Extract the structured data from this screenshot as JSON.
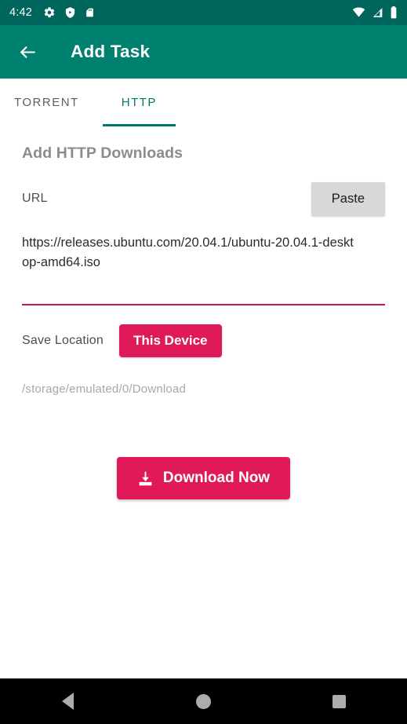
{
  "status_bar": {
    "clock": "4:42",
    "left_icons": [
      "gear-icon",
      "shield-play-icon",
      "sd-card-icon"
    ],
    "right_icons": [
      "wifi-icon",
      "cellular-signal-icon",
      "battery-icon"
    ],
    "background_color": "#00655a"
  },
  "app_bar": {
    "back_icon": "back-arrow-icon",
    "title": "Add Task",
    "background_color": "#00806f"
  },
  "tabs": [
    {
      "label": "TORRENT",
      "active": false
    },
    {
      "label": "HTTP",
      "active": true
    }
  ],
  "form": {
    "heading": "Add HTTP Downloads",
    "url_label": "URL",
    "paste_label": "Paste",
    "url_value": "https://releases.ubuntu.com/20.04.1/ubuntu-20.04.1-desktop-amd64.iso",
    "url_placeholder": "",
    "save_location_label": "Save Location",
    "save_location_value": "This Device",
    "save_path": "/storage/emulated/0/Download",
    "download_label": "Download Now",
    "download_icon": "download-icon"
  },
  "colors": {
    "accent_teal": "#00796b",
    "accent_pink": "#e01a59",
    "underline_pink": "#c2185b",
    "paste_gray": "#d8d8d8"
  },
  "nav_bar": {
    "back": "back-triangle-icon",
    "home": "home-circle-icon",
    "recents": "recents-square-icon"
  }
}
